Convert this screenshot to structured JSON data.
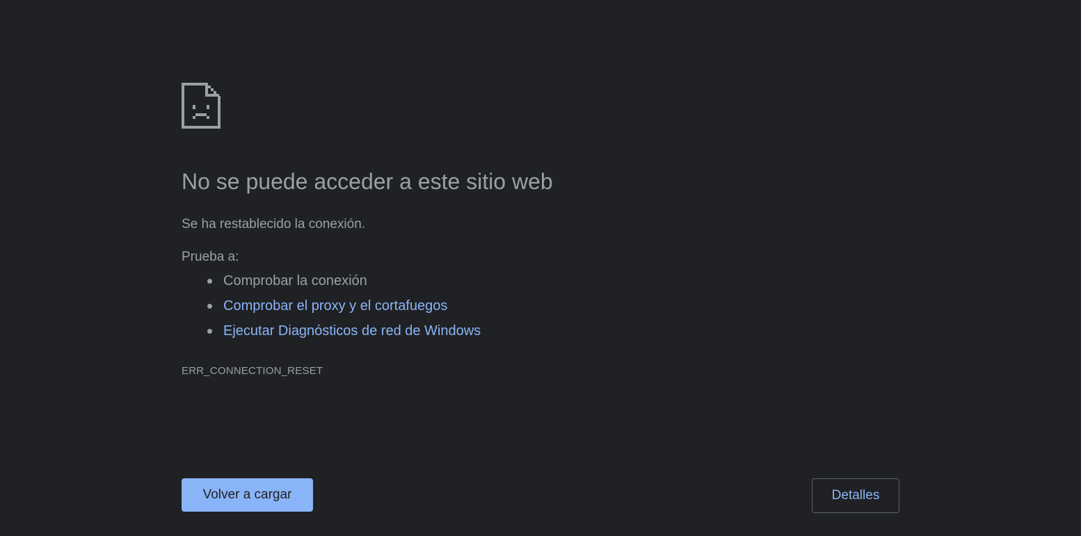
{
  "error_page": {
    "icon": "sad-document-icon",
    "heading": "No se puede acceder a este sitio web",
    "summary": "Se ha restablecido la conexión.",
    "suggestions_title": "Prueba a:",
    "suggestions": [
      {
        "label": "Comprobar la conexión",
        "is_link": false
      },
      {
        "label": "Comprobar el proxy y el cortafuegos",
        "is_link": true
      },
      {
        "label": "Ejecutar Diagnósticos de red de Windows",
        "is_link": true
      }
    ],
    "error_code": "ERR_CONNECTION_RESET",
    "reload_button": "Volver a cargar",
    "details_button": "Detalles"
  },
  "colors": {
    "background": "#202124",
    "text": "#9aa0a6",
    "link": "#8ab4f8",
    "primary_button": "#8ab4f8",
    "button_border": "#5f6368"
  }
}
